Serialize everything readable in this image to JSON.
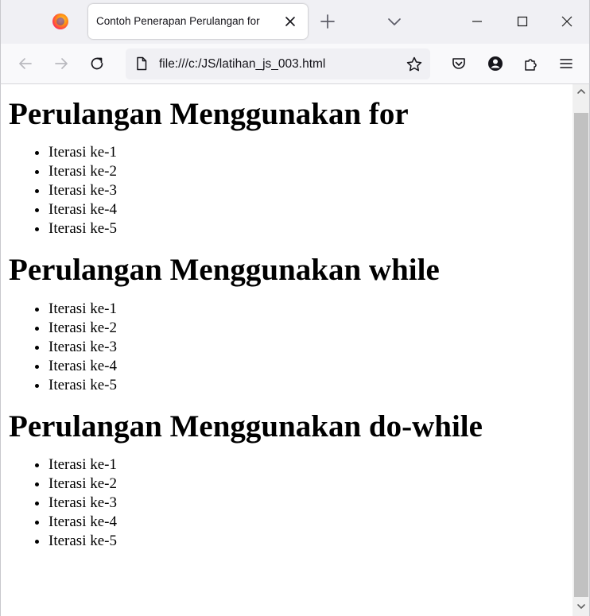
{
  "browser": {
    "tab": {
      "title": "Contoh Penerapan Perulangan for",
      "close_icon": "close-icon"
    },
    "toolbar_icons": [
      "firefox-logo-icon",
      "new-tab-icon",
      "tab-list-chevron-icon",
      "minimize-icon",
      "maximize-icon",
      "window-close-icon"
    ],
    "nav": {
      "url": "file:///c:/JS/latihan_js_003.html",
      "icons": [
        "back-arrow-icon",
        "forward-arrow-icon",
        "reload-icon",
        "page-icon",
        "bookmark-star-icon",
        "pocket-icon",
        "account-icon",
        "extensions-icon",
        "menu-icon"
      ]
    }
  },
  "page": {
    "sections": [
      {
        "heading": "Perulangan Menggunakan for",
        "items": [
          "Iterasi ke-1",
          "Iterasi ke-2",
          "Iterasi ke-3",
          "Iterasi ke-4",
          "Iterasi ke-5"
        ]
      },
      {
        "heading": "Perulangan Menggunakan while",
        "items": [
          "Iterasi ke-1",
          "Iterasi ke-2",
          "Iterasi ke-3",
          "Iterasi ke-4",
          "Iterasi ke-5"
        ]
      },
      {
        "heading": "Perulangan Menggunakan do-while",
        "items": [
          "Iterasi ke-1",
          "Iterasi ke-2",
          "Iterasi ke-3",
          "Iterasi ke-4",
          "Iterasi ke-5"
        ]
      }
    ]
  },
  "colors": {
    "tabstrip_bg": "#f0f0f4",
    "navbar_bg": "#f9f9fb",
    "urlbar_bg": "#f0f0f4",
    "icon": "#5b5b66",
    "scroll_thumb": "#c1c1c1"
  }
}
